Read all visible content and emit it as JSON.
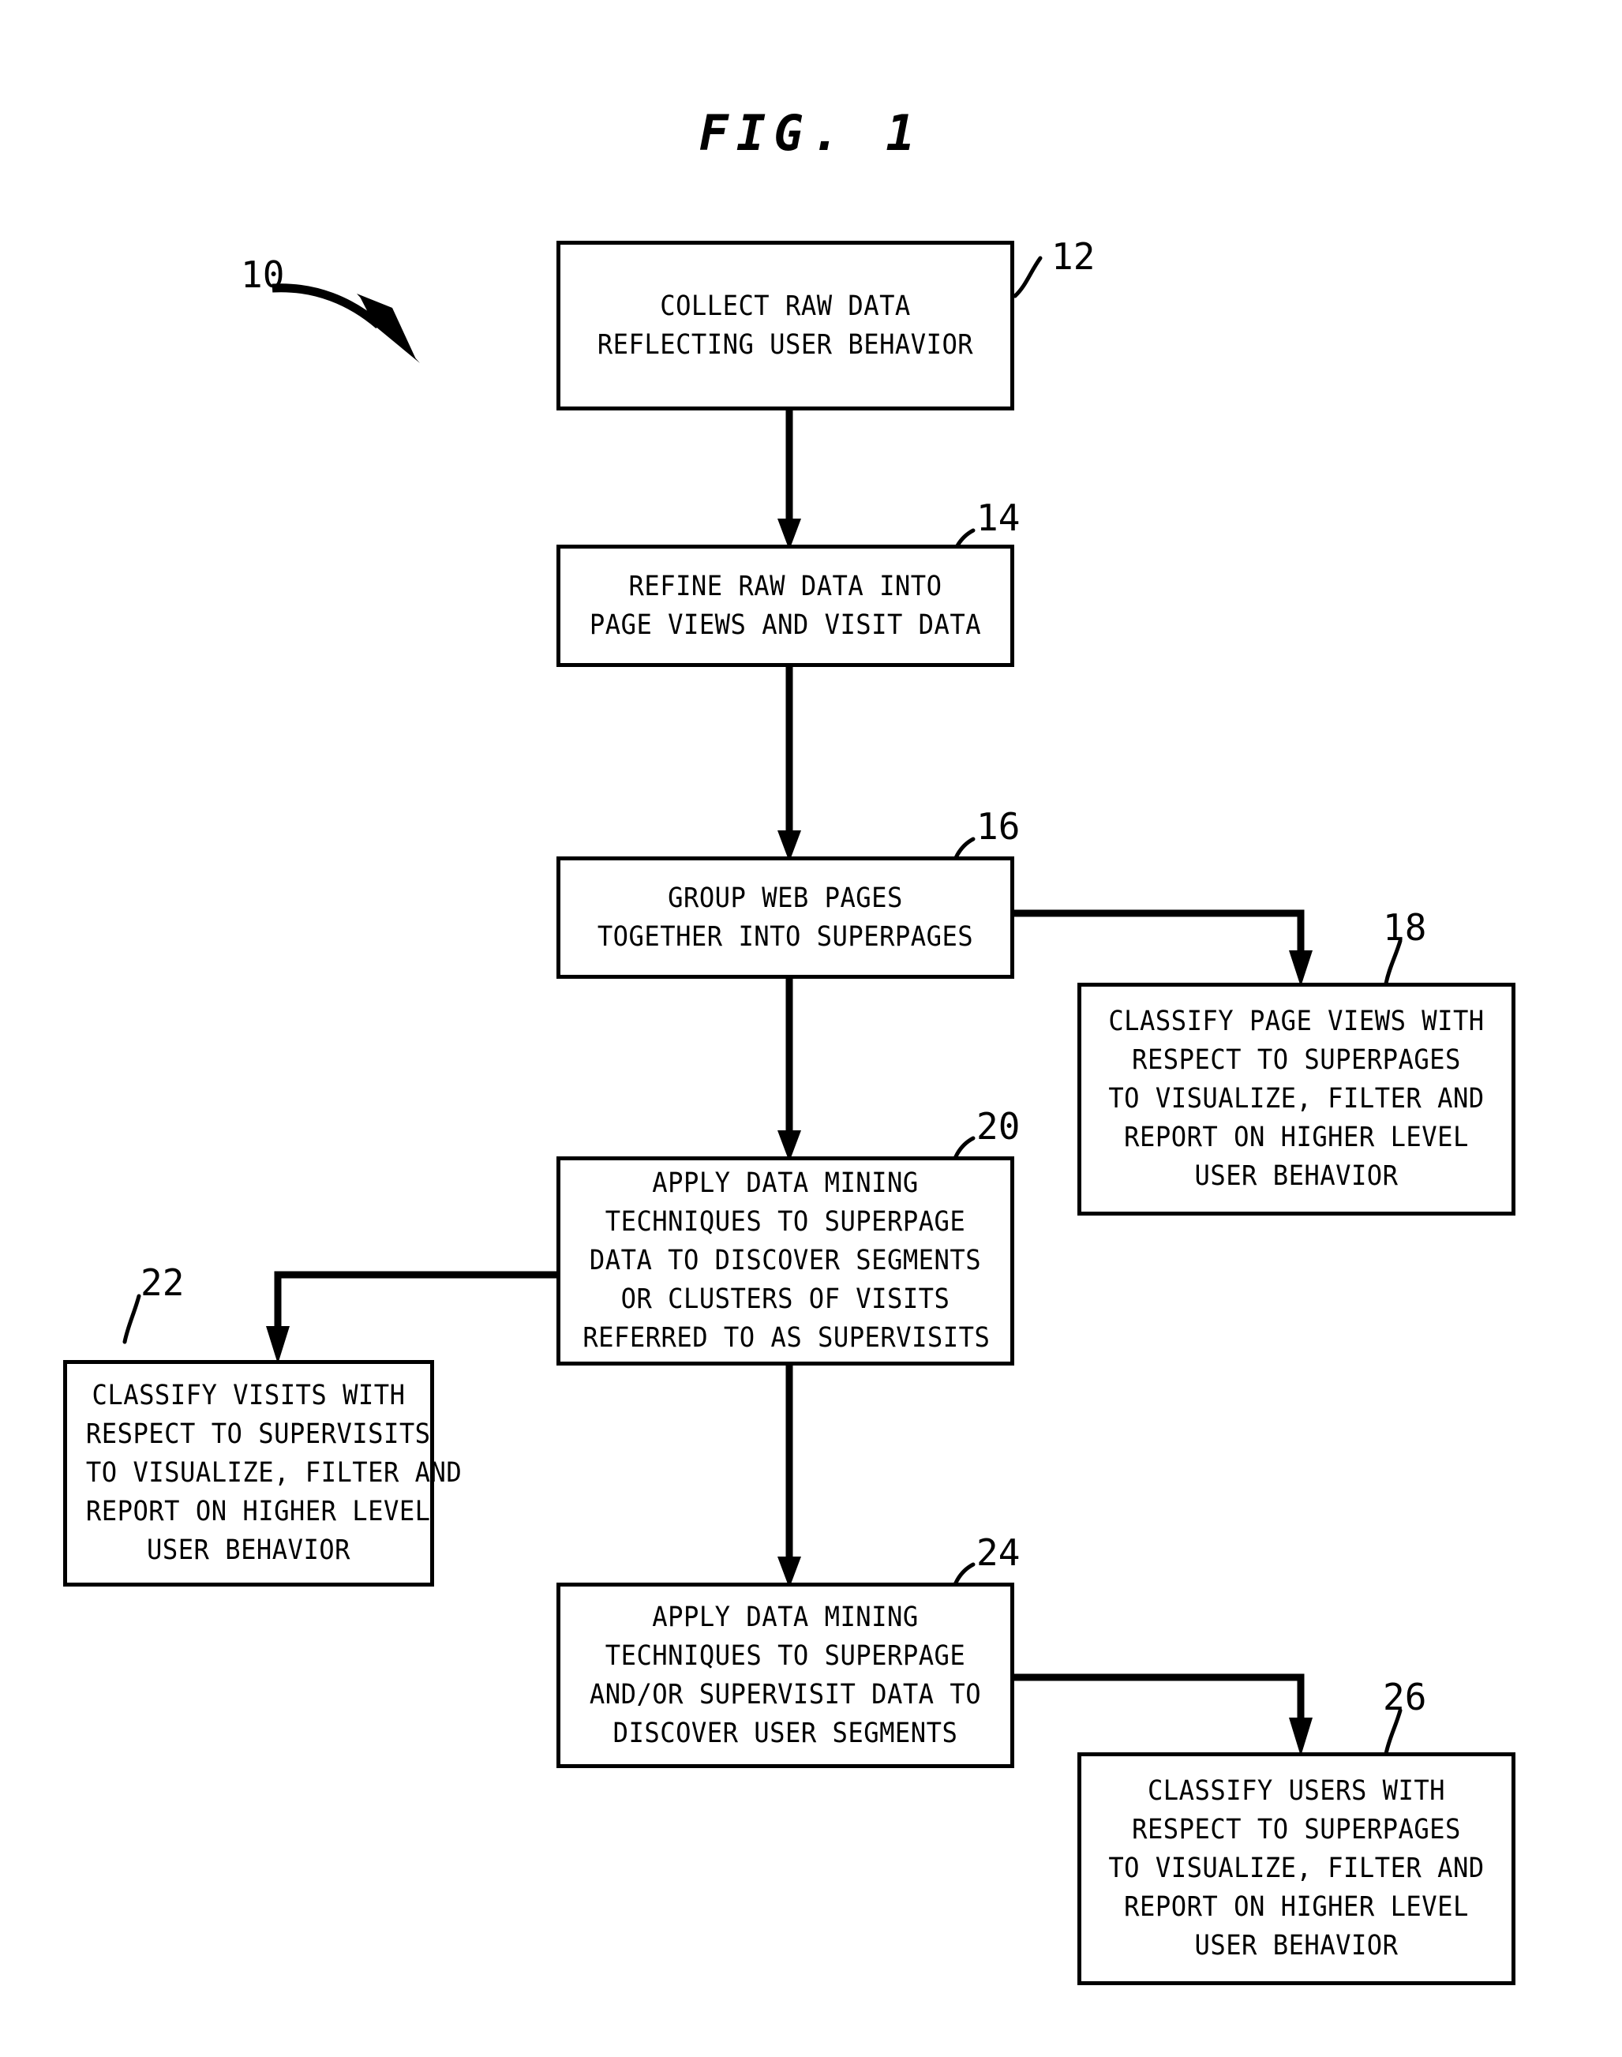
{
  "figure": {
    "title": "FIG. 1",
    "overall_ref": "10"
  },
  "nodes": [
    {
      "ref": "12",
      "name": "collect-raw-data",
      "lines": [
        "COLLECT RAW DATA",
        "REFLECTING USER BEHAVIOR"
      ]
    },
    {
      "ref": "14",
      "name": "refine-raw-data",
      "lines": [
        "REFINE RAW DATA INTO",
        "PAGE VIEWS AND VISIT DATA"
      ]
    },
    {
      "ref": "16",
      "name": "group-web-pages",
      "lines": [
        "GROUP WEB PAGES",
        "TOGETHER INTO SUPERPAGES"
      ]
    },
    {
      "ref": "18",
      "name": "classify-page-views",
      "lines": [
        "CLASSIFY PAGE VIEWS WITH",
        "RESPECT TO SUPERPAGES",
        "TO VISUALIZE, FILTER AND",
        "REPORT ON HIGHER LEVEL",
        "USER BEHAVIOR"
      ]
    },
    {
      "ref": "20",
      "name": "apply-data-mining-supervisits",
      "lines": [
        "APPLY DATA MINING",
        "TECHNIQUES TO SUPERPAGE",
        "DATA TO DISCOVER SEGMENTS",
        "OR CLUSTERS OF VISITS",
        "REFERRED TO AS SUPERVISITS"
      ]
    },
    {
      "ref": "22",
      "name": "classify-visits",
      "lines": [
        "CLASSIFY VISITS WITH",
        "RESPECT TO SUPERVISITS",
        "TO VISUALIZE, FILTER AND",
        "REPORT ON HIGHER LEVEL",
        "USER BEHAVIOR"
      ]
    },
    {
      "ref": "24",
      "name": "apply-data-mining-user-segments",
      "lines": [
        "APPLY DATA MINING",
        "TECHNIQUES TO SUPERPAGE",
        "AND/OR SUPERVISIT DATA TO",
        "DISCOVER USER SEGMENTS"
      ]
    },
    {
      "ref": "26",
      "name": "classify-users",
      "lines": [
        "CLASSIFY USERS WITH",
        "RESPECT TO SUPERPAGES",
        "TO VISUALIZE, FILTER AND",
        "REPORT ON HIGHER LEVEL",
        "USER BEHAVIOR"
      ]
    }
  ],
  "colors": {
    "ink": "#000000",
    "paper": "#ffffff"
  }
}
